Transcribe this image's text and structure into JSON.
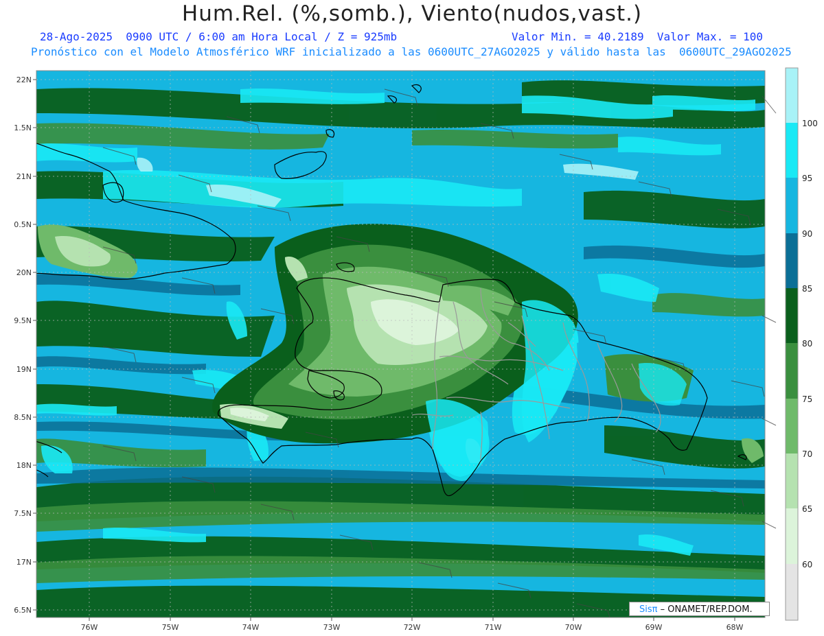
{
  "header": {
    "title": "Hum.Rel. (%,somb.), Viento(nudos,vast.)",
    "line1_left": "28-Ago-2025  0900 UTC / 6:00 am Hora Local / Z = 925mb",
    "line1_right": "Valor Min. = 40.2189  Valor Max. = 100",
    "line2": "Pronóstico con el Modelo Atmosférico WRF inicializado a las 0600UTC_27AGO2025 y válido hasta las  0600UTC_29AGO2025"
  },
  "axes": {
    "lat_labels": [
      "22N",
      "1.5N",
      "21N",
      "0.5N",
      "20N",
      "9.5N",
      "19N",
      "8.5N",
      "18N",
      "7.5N",
      "17N",
      "6.5N"
    ],
    "lon_labels": [
      "76W",
      "75W",
      "74W",
      "73W",
      "72W",
      "71W",
      "70W",
      "69W",
      "68W"
    ]
  },
  "colorbar": {
    "labels": [
      "100",
      "95",
      "90",
      "85",
      "80",
      "75",
      "70",
      "65",
      "60"
    ],
    "colors": [
      "#a8f2f7",
      "#19e9f5",
      "#16b6e0",
      "#0b6f96",
      "#0a5f1c",
      "#3a8f3e",
      "#6fba6a",
      "#b5e2b0",
      "#dcf4da",
      "#e4e4e4"
    ]
  },
  "credit": {
    "logo": "Sisπ",
    "text": "– ONAMET/REP.DOM."
  }
}
